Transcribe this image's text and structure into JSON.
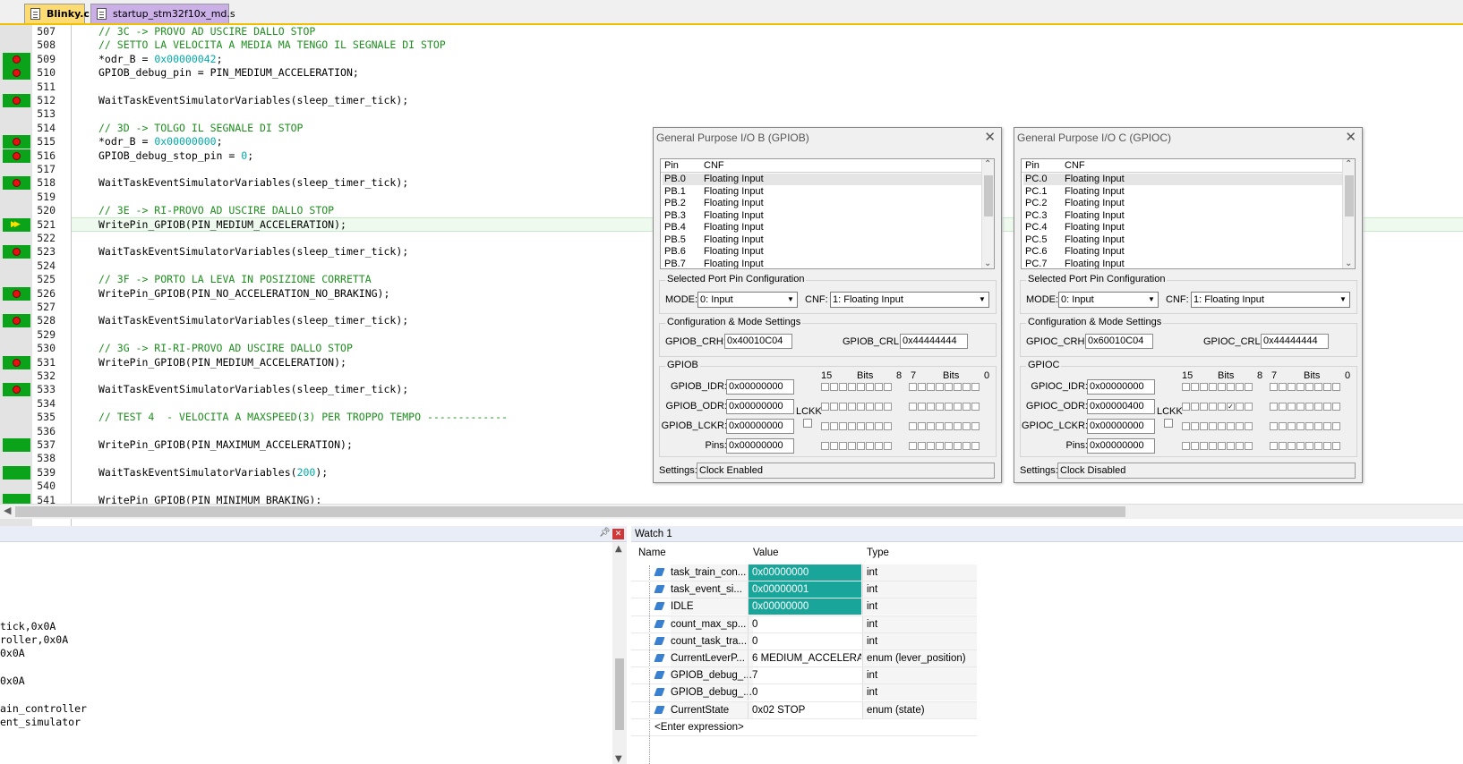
{
  "tabs": [
    {
      "label": "Blinky.c",
      "active": true
    },
    {
      "label": "startup_stm32f10x_md.s",
      "active": false
    }
  ],
  "colors": {
    "breakpoint_bar": "#0ba31a",
    "breakpoint_dot": "#e81010",
    "comment": "#1e8f1e",
    "number": "#00aaaa",
    "watch_highlight": "#1aa59b",
    "active_tab": "#fcdc72"
  },
  "editor": {
    "current_line": 521,
    "lines": [
      {
        "n": "507",
        "bp": "none",
        "kind": "comment",
        "pre": "// 3C -> PROVO AD USCIRE DALLO STOP",
        "num": "",
        "post": ""
      },
      {
        "n": "508",
        "bp": "none",
        "kind": "comment",
        "pre": "// SETTO LA VELOCITA A MEDIA MA TENGO IL SEGNALE DI STOP",
        "num": "",
        "post": ""
      },
      {
        "n": "509",
        "bp": "dot",
        "kind": "code",
        "pre": "*odr_B = ",
        "num": "0x00000042",
        "post": ";"
      },
      {
        "n": "510",
        "bp": "dot",
        "kind": "code",
        "pre": "GPIOB_debug_pin = PIN_MEDIUM_ACCELERATION;",
        "num": "",
        "post": ""
      },
      {
        "n": "511",
        "bp": "none",
        "kind": "code",
        "pre": "",
        "num": "",
        "post": ""
      },
      {
        "n": "512",
        "bp": "dot",
        "kind": "code",
        "pre": "WaitTaskEventSimulatorVariables(sleep_timer_tick);",
        "num": "",
        "post": ""
      },
      {
        "n": "513",
        "bp": "none",
        "kind": "code",
        "pre": "",
        "num": "",
        "post": ""
      },
      {
        "n": "514",
        "bp": "none",
        "kind": "comment",
        "pre": "// 3D -> TOLGO IL SEGNALE DI STOP",
        "num": "",
        "post": ""
      },
      {
        "n": "515",
        "bp": "dot",
        "kind": "code",
        "pre": "*odr_B = ",
        "num": "0x00000000",
        "post": ";"
      },
      {
        "n": "516",
        "bp": "dot",
        "kind": "code",
        "pre": "GPIOB_debug_stop_pin = ",
        "num": "0",
        "post": ";"
      },
      {
        "n": "517",
        "bp": "none",
        "kind": "code",
        "pre": "",
        "num": "",
        "post": ""
      },
      {
        "n": "518",
        "bp": "dot",
        "kind": "code",
        "pre": "WaitTaskEventSimulatorVariables(sleep_timer_tick);",
        "num": "",
        "post": ""
      },
      {
        "n": "519",
        "bp": "none",
        "kind": "code",
        "pre": "",
        "num": "",
        "post": ""
      },
      {
        "n": "520",
        "bp": "none",
        "kind": "comment",
        "pre": "// 3E -> RI-PROVO AD USCIRE DALLO STOP",
        "num": "",
        "post": ""
      },
      {
        "n": "521",
        "bp": "arrow",
        "kind": "code",
        "pre": "WritePin_GPIOB(PIN_MEDIUM_ACCELERATION);",
        "num": "",
        "post": ""
      },
      {
        "n": "522",
        "bp": "none",
        "kind": "code",
        "pre": "",
        "num": "",
        "post": ""
      },
      {
        "n": "523",
        "bp": "dot",
        "kind": "code",
        "pre": "WaitTaskEventSimulatorVariables(sleep_timer_tick);",
        "num": "",
        "post": ""
      },
      {
        "n": "524",
        "bp": "none",
        "kind": "code",
        "pre": "",
        "num": "",
        "post": ""
      },
      {
        "n": "525",
        "bp": "none",
        "kind": "comment",
        "pre": "// 3F -> PORTO LA LEVA IN POSIZIONE CORRETTA",
        "num": "",
        "post": ""
      },
      {
        "n": "526",
        "bp": "dot",
        "kind": "code",
        "pre": "WritePin_GPIOB(PIN_NO_ACCELERATION_NO_BRAKING);",
        "num": "",
        "post": ""
      },
      {
        "n": "527",
        "bp": "none",
        "kind": "code",
        "pre": "",
        "num": "",
        "post": ""
      },
      {
        "n": "528",
        "bp": "dot",
        "kind": "code",
        "pre": "WaitTaskEventSimulatorVariables(sleep_timer_tick);",
        "num": "",
        "post": ""
      },
      {
        "n": "529",
        "bp": "none",
        "kind": "code",
        "pre": "",
        "num": "",
        "post": ""
      },
      {
        "n": "530",
        "bp": "none",
        "kind": "comment",
        "pre": "// 3G -> RI-RI-PROVO AD USCIRE DALLO STOP",
        "num": "",
        "post": ""
      },
      {
        "n": "531",
        "bp": "dot",
        "kind": "code",
        "pre": "WritePin_GPIOB(PIN_MEDIUM_ACCELERATION);",
        "num": "",
        "post": ""
      },
      {
        "n": "532",
        "bp": "none",
        "kind": "code",
        "pre": "",
        "num": "",
        "post": ""
      },
      {
        "n": "533",
        "bp": "dot",
        "kind": "code",
        "pre": "WaitTaskEventSimulatorVariables(sleep_timer_tick);",
        "num": "",
        "post": ""
      },
      {
        "n": "534",
        "bp": "none",
        "kind": "code",
        "pre": "",
        "num": "",
        "post": ""
      },
      {
        "n": "535",
        "bp": "none",
        "kind": "comment",
        "pre": "// TEST 4  - VELOCITA A MAXSPEED(3) PER TROPPO TEMPO -------------",
        "num": "",
        "post": ""
      },
      {
        "n": "536",
        "bp": "none",
        "kind": "code",
        "pre": "",
        "num": "",
        "post": ""
      },
      {
        "n": "537",
        "bp": "bar",
        "kind": "code",
        "pre": "WritePin_GPIOB(PIN_MAXIMUM_ACCELERATION);",
        "num": "",
        "post": ""
      },
      {
        "n": "538",
        "bp": "none",
        "kind": "code",
        "pre": "",
        "num": "",
        "post": ""
      },
      {
        "n": "539",
        "bp": "bar",
        "kind": "code",
        "pre": "WaitTaskEventSimulatorVariables(",
        "num": "200",
        "post": ");"
      },
      {
        "n": "540",
        "bp": "none",
        "kind": "code",
        "pre": "",
        "num": "",
        "post": ""
      },
      {
        "n": "541",
        "bp": "bar",
        "kind": "code",
        "pre": "WritePin_GPIOB(PIN_MINIMUM_BRAKING);",
        "num": "",
        "post": ""
      }
    ]
  },
  "gpio_dialogs": [
    {
      "title": "General Purpose I/O B (GPIOB)",
      "col_pin": "Pin",
      "col_cnf": "CNF",
      "pins": [
        [
          "PB.0",
          "Floating Input"
        ],
        [
          "PB.1",
          "Floating Input"
        ],
        [
          "PB.2",
          "Floating Input"
        ],
        [
          "PB.3",
          "Floating Input"
        ],
        [
          "PB.4",
          "Floating Input"
        ],
        [
          "PB.5",
          "Floating Input"
        ],
        [
          "PB.6",
          "Floating Input"
        ],
        [
          "PB.7",
          "Floating Input"
        ]
      ],
      "spc_label": "Selected Port Pin Configuration",
      "mode_label": "MODE:",
      "mode_value": "0: Input",
      "cnf_label": "CNF:",
      "cnf_value": "1: Floating Input",
      "cms_label": "Configuration & Mode Settings",
      "crh_label": "GPIOB_CRH:",
      "crh_value": "0x40010C04",
      "crl_label": "GPIOB_CRL:",
      "crl_value": "0x44444444",
      "group_label": "GPIOB",
      "bits_hi": "15",
      "bits_lbl1": "Bits",
      "bits_8": "8",
      "bits_7": "7",
      "bits_lbl2": "Bits",
      "bits_0": "0",
      "regs": [
        [
          "GPIOB_IDR:",
          "0x00000000"
        ],
        [
          "GPIOB_ODR:",
          "0x00000000"
        ],
        [
          "GPIOB_LCKR:",
          "0x00000000"
        ],
        [
          "Pins:",
          "0x00000000"
        ]
      ],
      "odr_checked_bit": -1,
      "lckk": "LCKK",
      "settings_label": "Settings:",
      "settings_value": "Clock Enabled"
    },
    {
      "title": "General Purpose I/O C (GPIOC)",
      "col_pin": "Pin",
      "col_cnf": "CNF",
      "pins": [
        [
          "PC.0",
          "Floating Input"
        ],
        [
          "PC.1",
          "Floating Input"
        ],
        [
          "PC.2",
          "Floating Input"
        ],
        [
          "PC.3",
          "Floating Input"
        ],
        [
          "PC.4",
          "Floating Input"
        ],
        [
          "PC.5",
          "Floating Input"
        ],
        [
          "PC.6",
          "Floating Input"
        ],
        [
          "PC.7",
          "Floating Input"
        ]
      ],
      "spc_label": "Selected Port Pin Configuration",
      "mode_label": "MODE:",
      "mode_value": "0: Input",
      "cnf_label": "CNF:",
      "cnf_value": "1: Floating Input",
      "cms_label": "Configuration & Mode Settings",
      "crh_label": "GPIOC_CRH:",
      "crh_value": "0x60010C04",
      "crl_label": "GPIOC_CRL:",
      "crl_value": "0x44444444",
      "group_label": "GPIOC",
      "bits_hi": "15",
      "bits_lbl1": "Bits",
      "bits_8": "8",
      "bits_7": "7",
      "bits_lbl2": "Bits",
      "bits_0": "0",
      "regs": [
        [
          "GPIOC_IDR:",
          "0x00000000"
        ],
        [
          "GPIOC_ODR:",
          "0x00000400"
        ],
        [
          "GPIOC_LCKR:",
          "0x00000000"
        ],
        [
          "Pins:",
          "0x00000000"
        ]
      ],
      "odr_checked_bit": 10,
      "lckk": "LCKK",
      "settings_label": "Settings:",
      "settings_value": "Clock Disabled"
    }
  ],
  "command": {
    "lines": [
      "",
      "",
      "",
      "",
      "tick,0x0A",
      "roller,0x0A",
      "0x0A",
      "",
      "0x0A",
      "",
      "ain_controller",
      "ent_simulator"
    ]
  },
  "watch": {
    "title": "Watch 1",
    "headers": {
      "name": "Name",
      "value": "Value",
      "type": "Type"
    },
    "rows": [
      {
        "name": "task_train_con...",
        "value": "0x00000000",
        "type": "int",
        "hl": true
      },
      {
        "name": "task_event_si...",
        "value": "0x00000001",
        "type": "int",
        "hl": true
      },
      {
        "name": "IDLE",
        "value": "0x00000000",
        "type": "int",
        "hl": true
      },
      {
        "name": "count_max_sp...",
        "value": "0",
        "type": "int",
        "hl": false
      },
      {
        "name": "count_task_tra...",
        "value": "0",
        "type": "int",
        "hl": false
      },
      {
        "name": "CurrentLeverP...",
        "value": "6 MEDIUM_ACCELERA...",
        "type": "enum (lever_position)",
        "hl": false
      },
      {
        "name": "GPIOB_debug_...",
        "value": "7",
        "type": "int",
        "hl": false
      },
      {
        "name": "GPIOB_debug_...",
        "value": "0",
        "type": "int",
        "hl": false
      },
      {
        "name": "CurrentState",
        "value": "0x02 STOP",
        "type": "enum (state)",
        "hl": false
      }
    ],
    "enter_expression": "<Enter expression>"
  }
}
